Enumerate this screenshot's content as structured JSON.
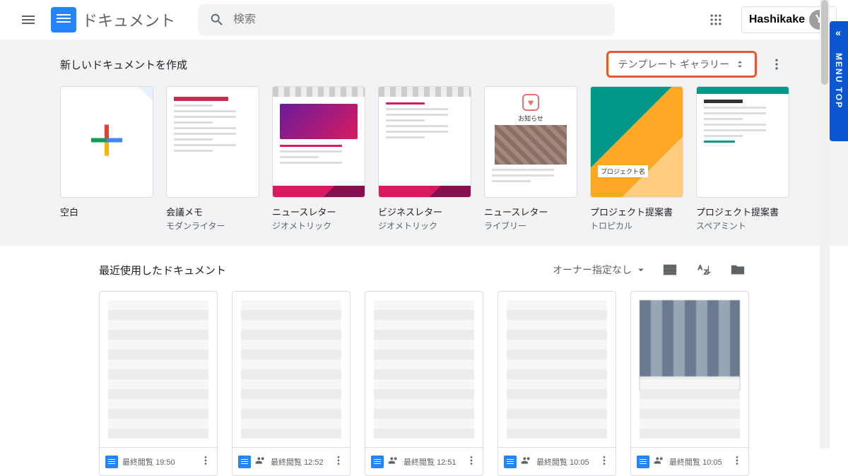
{
  "header": {
    "app_name": "ドキュメント",
    "search_placeholder": "検索",
    "brand_text": "Hashikake",
    "avatar_initial": "Y"
  },
  "templates": {
    "title": "新しいドキュメントを作成",
    "gallery_label": "テンプレート ギャラリー",
    "cards": [
      {
        "title": "空白",
        "subtitle": ""
      },
      {
        "title": "会議メモ",
        "subtitle": "モダンライター"
      },
      {
        "title": "ニュースレター",
        "subtitle": "ジオメトリック"
      },
      {
        "title": "ビジネスレター",
        "subtitle": "ジオメトリック"
      },
      {
        "title": "ニュースレター",
        "subtitle": "ライブリー"
      },
      {
        "title": "プロジェクト提案書",
        "subtitle": "トロピカル"
      },
      {
        "title": "プロジェクト提案書",
        "subtitle": "スペアミント"
      }
    ]
  },
  "recent": {
    "title": "最近使用したドキュメント",
    "owner_filter": "オーナー指定なし",
    "docs": [
      {
        "meta_prefix": "最終閲覧",
        "time": "19:50"
      },
      {
        "meta_prefix": "最終閲覧",
        "time": "12:52"
      },
      {
        "meta_prefix": "最終閲覧",
        "time": "12:51"
      },
      {
        "meta_prefix": "最終閲覧",
        "time": "10:05"
      },
      {
        "meta_prefix": "最終閲覧",
        "time": "10:05"
      }
    ]
  },
  "side_tab": "MENU TOP"
}
